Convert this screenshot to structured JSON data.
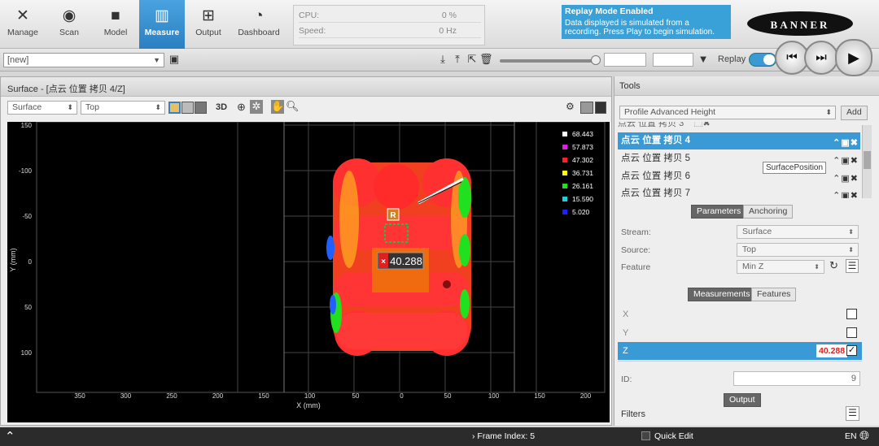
{
  "nav": {
    "items": [
      {
        "label": "Manage",
        "icon": "wrench-screwdriver-icon"
      },
      {
        "label": "Scan",
        "icon": "scan-icon"
      },
      {
        "label": "Model",
        "icon": "cube-icon"
      },
      {
        "label": "Measure",
        "icon": "ruler-icon",
        "active": true
      },
      {
        "label": "Output",
        "icon": "network-icon"
      },
      {
        "label": "Dashboard",
        "icon": "gauge-icon"
      }
    ]
  },
  "stats": {
    "cpu_label": "CPU:",
    "cpu_value": "0 %",
    "speed_label": "Speed:",
    "speed_value": "0 Hz"
  },
  "replay_notice": {
    "title": "Replay Mode Enabled",
    "text": "Data displayed is simulated from a recording. Press Play to begin simulation."
  },
  "logo": "BANNER",
  "toolbar": {
    "job": "[new]",
    "replay_label": "Replay"
  },
  "surface_panel": {
    "title": "Surface - [点云 位置 拷贝 4/Z]",
    "surface_select": "Surface",
    "view_select": "Top",
    "btn_3d": "3D"
  },
  "plot": {
    "x_label": "X (mm)",
    "y_label": "Y (mm)",
    "x_ticks": [
      "350",
      "300",
      "250",
      "200",
      "150",
      "100",
      "50",
      "0",
      "50",
      "100",
      "150",
      "200"
    ],
    "y_ticks": [
      "150",
      "-100",
      "-50",
      "0",
      "50",
      "100"
    ],
    "marker_value": "40.288",
    "anchor_label": "R",
    "legend": [
      {
        "value": "68.443",
        "color": "#ffffff"
      },
      {
        "value": "57.873",
        "color": "#e020e0"
      },
      {
        "value": "47.302",
        "color": "#ff2020"
      },
      {
        "value": "36.731",
        "color": "#ffff00"
      },
      {
        "value": "26.161",
        "color": "#20e020"
      },
      {
        "value": "15.590",
        "color": "#20d0e0"
      },
      {
        "value": "5.020",
        "color": "#2020ff"
      }
    ]
  },
  "tools": {
    "title": "Tools",
    "tool_select": "Profile Advanced Height",
    "add_label": "Add",
    "list": [
      {
        "label": "点云 位置 拷贝 4",
        "selected": true
      },
      {
        "label": "点云 位置 拷贝 5",
        "selected": false
      },
      {
        "label": "点云 位置 拷贝 6",
        "selected": false
      },
      {
        "label": "点云 位置 拷贝 7",
        "selected": false
      }
    ],
    "tooltip": "SurfacePosition",
    "tabs": [
      "Parameters",
      "Anchoring"
    ],
    "params": [
      {
        "label": "Stream:",
        "value": "Surface"
      },
      {
        "label": "Source:",
        "value": "Top"
      },
      {
        "label": "Feature",
        "value": "Min Z"
      }
    ],
    "mtabs": [
      "Measurements",
      "Features"
    ],
    "measurements": [
      {
        "label": "X",
        "value": "",
        "checked": false
      },
      {
        "label": "Y",
        "value": "",
        "checked": false
      },
      {
        "label": "Z",
        "value": "40.288",
        "checked": true
      }
    ],
    "id_label": "ID:",
    "id_value": "9",
    "output_label": "Output",
    "filters_label": "Filters"
  },
  "statusbar": {
    "frame_index": "Frame Index: 5",
    "quick_edit": "Quick Edit",
    "lang": "EN"
  }
}
